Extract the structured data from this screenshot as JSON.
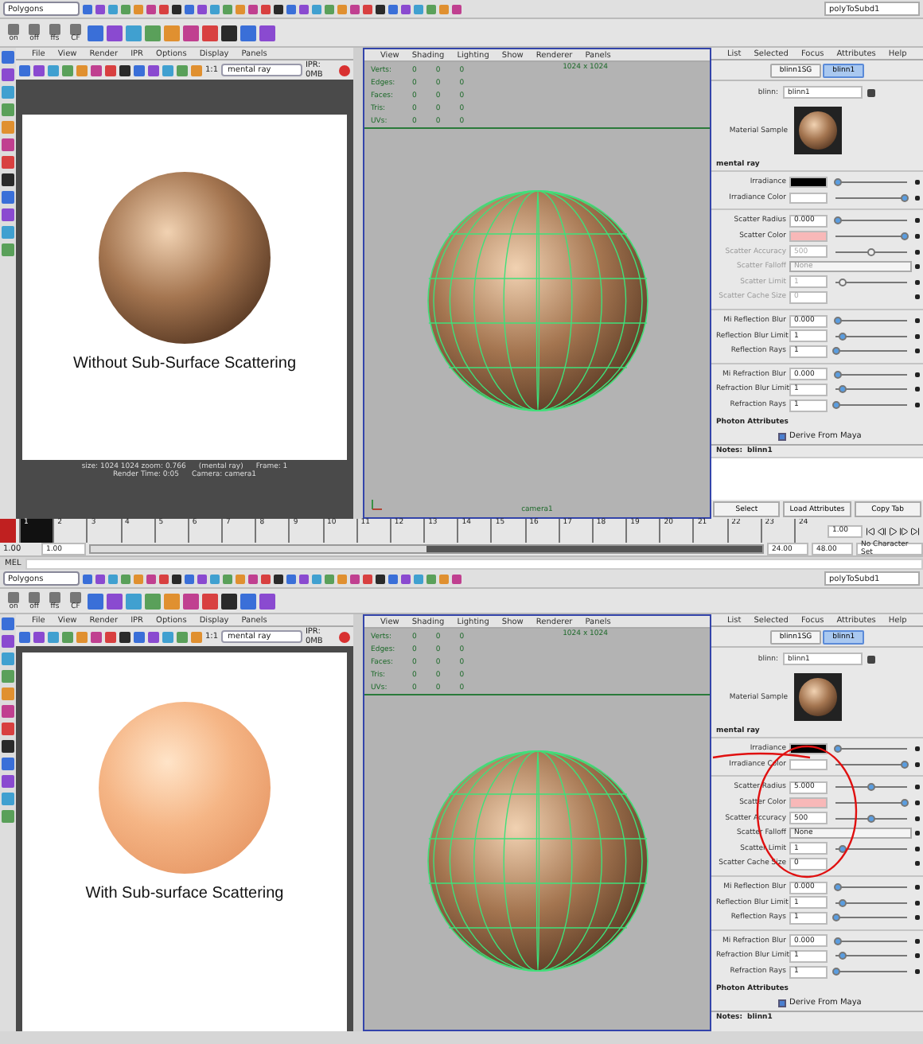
{
  "panels": [
    {
      "status_line": {
        "mode": "Polygons",
        "object_field": "polyToSubd1"
      },
      "shelf_labels": [
        "on",
        "off",
        "ffs",
        "CF"
      ],
      "render_view": {
        "menus": [
          "File",
          "View",
          "Render",
          "IPR",
          "Options",
          "Display",
          "Panels"
        ],
        "renderer": "mental ray",
        "ratio": "1:1",
        "ipr": "IPR: 0MB",
        "scattering": false,
        "caption": "Without Sub-Surface Scattering",
        "status_text": [
          "size: 1024 1024  zoom: 0.766",
          "(mental ray)",
          "Frame: 1",
          "Render Time: 0:05",
          "Camera: camera1"
        ]
      },
      "viewport": {
        "menus": [
          "View",
          "Shading",
          "Lighting",
          "Show",
          "Renderer",
          "Panels"
        ],
        "hud": [
          {
            "label": "Verts:",
            "values": [
              "0",
              "0",
              "0"
            ]
          },
          {
            "label": "Edges:",
            "values": [
              "0",
              "0",
              "0"
            ]
          },
          {
            "label": "Faces:",
            "values": [
              "0",
              "0",
              "0"
            ]
          },
          {
            "label": "Tris:",
            "values": [
              "0",
              "0",
              "0"
            ]
          },
          {
            "label": "UVs:",
            "values": [
              "0",
              "0",
              "0"
            ]
          }
        ],
        "resolution": "1024 x 1024",
        "camera": "camera1"
      },
      "attribute_editor": {
        "menus": [
          "List",
          "Selected",
          "Focus",
          "Attributes",
          "Help"
        ],
        "tabs": [
          {
            "label": "blinn1SG",
            "selected": false
          },
          {
            "label": "blinn1",
            "selected": true
          }
        ],
        "node_label": "blinn:",
        "node_name": "blinn1",
        "sample_label": "Material Sample",
        "section": "mental ray",
        "groups": [
          {
            "rows": [
              {
                "kind": "color",
                "label": "Irradiance",
                "color": "#000000",
                "level": 0.03,
                "disabled": false
              },
              {
                "kind": "color",
                "label": "Irradiance Color",
                "color": "#ffffff",
                "level": 0.97,
                "disabled": false
              }
            ]
          },
          {
            "rows": [
              {
                "kind": "number",
                "label": "Scatter Radius",
                "value": "0.000",
                "level": 0.03,
                "disabled": false
              },
              {
                "kind": "color",
                "label": "Scatter Color",
                "color": "#f8b8b8",
                "level": 0.97,
                "disabled": false
              },
              {
                "kind": "number",
                "label": "Scatter Accuracy",
                "value": "500",
                "level": 0.5,
                "disabled": true
              },
              {
                "kind": "dropdown",
                "label": "Scatter Falloff",
                "value": "None",
                "disabled": true
              },
              {
                "kind": "number",
                "label": "Scatter Limit",
                "value": "1",
                "level": 0.1,
                "disabled": true
              },
              {
                "kind": "number",
                "label": "Scatter Cache Size",
                "value": "0",
                "disabled": true
              }
            ]
          },
          {
            "rows": [
              {
                "kind": "number",
                "label": "Mi Reflection Blur",
                "value": "0.000",
                "level": 0.03,
                "disabled": false
              },
              {
                "kind": "number",
                "label": "Reflection Blur Limit",
                "value": "1",
                "level": 0.1,
                "disabled": false
              },
              {
                "kind": "number",
                "label": "Reflection Rays",
                "value": "1",
                "level": 0.02,
                "disabled": false
              }
            ]
          },
          {
            "rows": [
              {
                "kind": "number",
                "label": "Mi Refraction Blur",
                "value": "0.000",
                "level": 0.03,
                "disabled": false
              },
              {
                "kind": "number",
                "label": "Refraction Blur Limit",
                "value": "1",
                "level": 0.1,
                "disabled": false
              },
              {
                "kind": "number",
                "label": "Refraction Rays",
                "value": "1",
                "level": 0.02,
                "disabled": false
              }
            ]
          }
        ],
        "photon_section": "Photon Attributes",
        "derive": {
          "label": "Derive From Maya",
          "checked": true
        },
        "notes_label": "Notes:",
        "notes_value": "blinn1",
        "buttons": [
          "Select",
          "Load Attributes",
          "Copy Tab"
        ]
      },
      "annotated": false
    },
    {
      "status_line": {
        "mode": "Polygons",
        "object_field": "polyToSubd1"
      },
      "shelf_labels": [
        "on",
        "off",
        "ffs",
        "CF"
      ],
      "render_view": {
        "menus": [
          "File",
          "View",
          "Render",
          "IPR",
          "Options",
          "Display",
          "Panels"
        ],
        "renderer": "mental ray",
        "ratio": "1:1",
        "ipr": "IPR: 0MB",
        "scattering": true,
        "caption": "With Sub-surface Scattering"
      },
      "viewport": {
        "menus": [
          "View",
          "Shading",
          "Lighting",
          "Show",
          "Renderer",
          "Panels"
        ],
        "hud": [
          {
            "label": "Verts:",
            "values": [
              "0",
              "0",
              "0"
            ]
          },
          {
            "label": "Edges:",
            "values": [
              "0",
              "0",
              "0"
            ]
          },
          {
            "label": "Faces:",
            "values": [
              "0",
              "0",
              "0"
            ]
          },
          {
            "label": "Tris:",
            "values": [
              "0",
              "0",
              "0"
            ]
          },
          {
            "label": "UVs:",
            "values": [
              "0",
              "0",
              "0"
            ]
          }
        ],
        "resolution": "1024 x 1024"
      },
      "attribute_editor": {
        "menus": [
          "List",
          "Selected",
          "Focus",
          "Attributes",
          "Help"
        ],
        "tabs": [
          {
            "label": "blinn1SG",
            "selected": false
          },
          {
            "label": "blinn1",
            "selected": true
          }
        ],
        "node_label": "blinn:",
        "node_name": "blinn1",
        "sample_label": "Material Sample",
        "section": "mental ray",
        "groups": [
          {
            "rows": [
              {
                "kind": "color",
                "label": "Irradiance",
                "color": "#000000",
                "level": 0.03,
                "disabled": false
              },
              {
                "kind": "color",
                "label": "Irradiance Color",
                "color": "#ffffff",
                "level": 0.97,
                "disabled": false
              }
            ]
          },
          {
            "rows": [
              {
                "kind": "number",
                "label": "Scatter Radius",
                "value": "5.000",
                "level": 0.5,
                "disabled": false
              },
              {
                "kind": "color",
                "label": "Scatter Color",
                "color": "#f8b8b8",
                "level": 0.97,
                "disabled": false
              },
              {
                "kind": "number",
                "label": "Scatter Accuracy",
                "value": "500",
                "level": 0.5,
                "disabled": false
              },
              {
                "kind": "dropdown",
                "label": "Scatter Falloff",
                "value": "None",
                "disabled": false
              },
              {
                "kind": "number",
                "label": "Scatter Limit",
                "value": "1",
                "level": 0.1,
                "disabled": false
              },
              {
                "kind": "number",
                "label": "Scatter Cache Size",
                "value": "0",
                "disabled": false
              }
            ]
          },
          {
            "rows": [
              {
                "kind": "number",
                "label": "Mi Reflection Blur",
                "value": "0.000",
                "level": 0.03,
                "disabled": false
              },
              {
                "kind": "number",
                "label": "Reflection Blur Limit",
                "value": "1",
                "level": 0.1,
                "disabled": false
              },
              {
                "kind": "number",
                "label": "Reflection Rays",
                "value": "1",
                "level": 0.02,
                "disabled": false
              }
            ]
          },
          {
            "rows": [
              {
                "kind": "number",
                "label": "Mi Refraction Blur",
                "value": "0.000",
                "level": 0.03,
                "disabled": false
              },
              {
                "kind": "number",
                "label": "Refraction Blur Limit",
                "value": "1",
                "level": 0.1,
                "disabled": false
              },
              {
                "kind": "number",
                "label": "Refraction Rays",
                "value": "1",
                "level": 0.02,
                "disabled": false
              }
            ]
          }
        ],
        "photon_section": "Photon Attributes",
        "derive": {
          "label": "Derive From Maya",
          "checked": true
        },
        "notes_label": "Notes:",
        "notes_value": "blinn1"
      },
      "annotated": true
    }
  ],
  "timeline": {
    "frames": [
      {
        "label": "1",
        "selected": true
      },
      {
        "label": "2",
        "selected": false
      },
      {
        "label": "3",
        "selected": false
      },
      {
        "label": "4",
        "selected": false
      },
      {
        "label": "5",
        "selected": false
      },
      {
        "label": "6",
        "selected": false
      },
      {
        "label": "7",
        "selected": false
      },
      {
        "label": "8",
        "selected": false
      },
      {
        "label": "9",
        "selected": false
      },
      {
        "label": "10",
        "selected": false
      },
      {
        "label": "11",
        "selected": false
      },
      {
        "label": "12",
        "selected": false
      },
      {
        "label": "13",
        "selected": false
      },
      {
        "label": "14",
        "selected": false
      },
      {
        "label": "15",
        "selected": false
      },
      {
        "label": "16",
        "selected": false
      },
      {
        "label": "17",
        "selected": false
      },
      {
        "label": "18",
        "selected": false
      },
      {
        "label": "19",
        "selected": false
      },
      {
        "label": "20",
        "selected": false
      },
      {
        "label": "21",
        "selected": false
      },
      {
        "label": "22",
        "selected": false
      },
      {
        "label": "23",
        "selected": false
      },
      {
        "label": "24",
        "selected": false
      }
    ],
    "range": {
      "level": 0.5
    },
    "current_time": "1.00",
    "start": "1.00",
    "range_start": "1.00",
    "range_end": "24.00",
    "end": "48.00",
    "character_set": "No Character Set",
    "command_label": "MEL"
  }
}
